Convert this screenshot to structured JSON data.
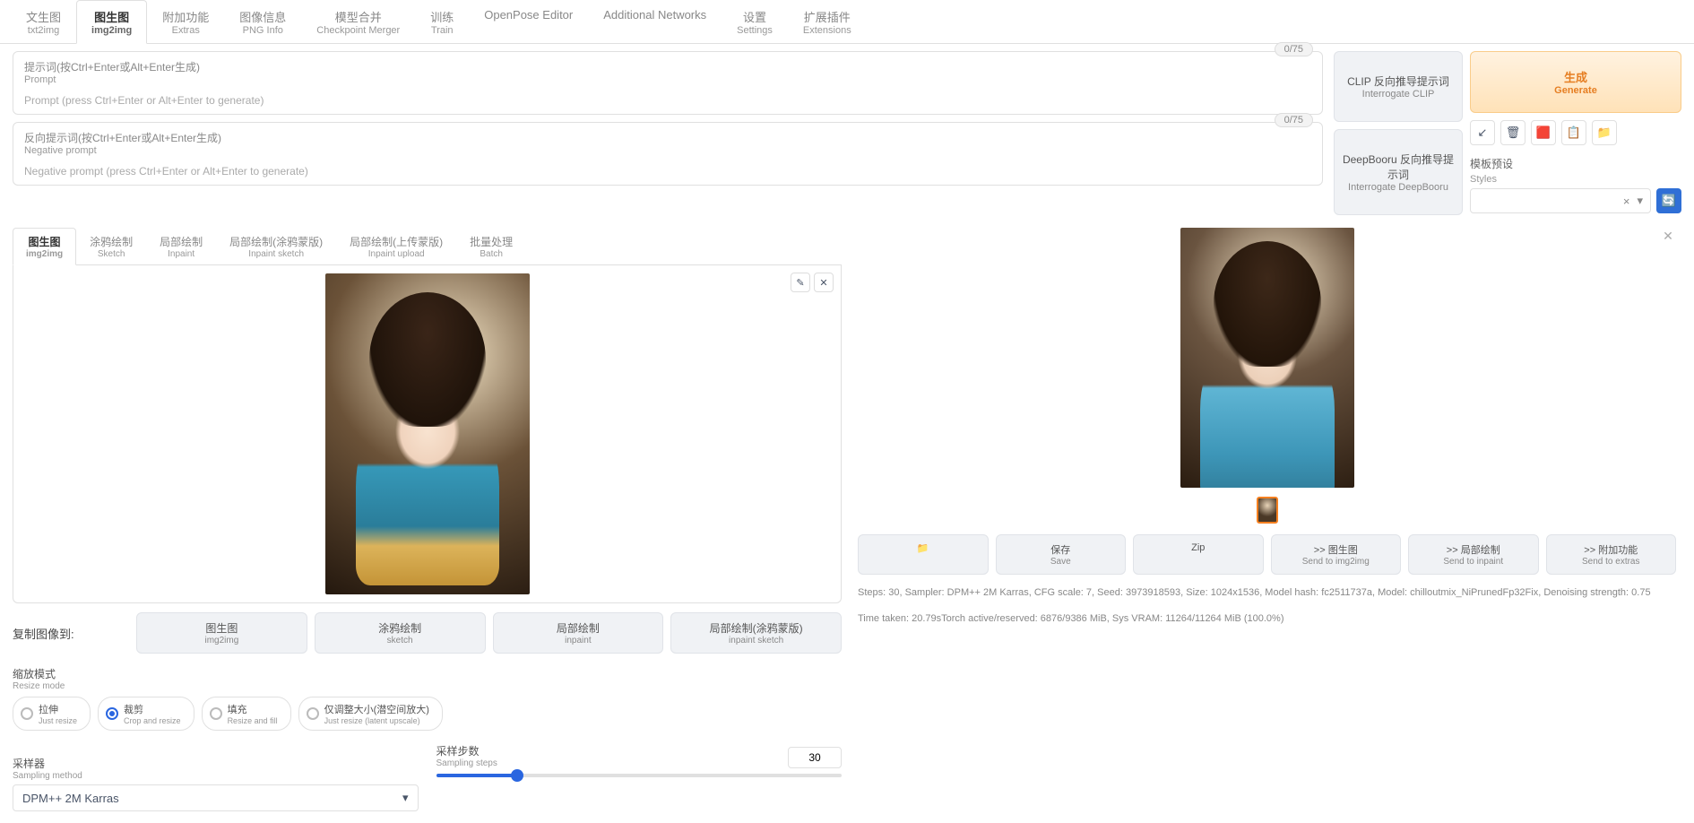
{
  "mainTabs": [
    {
      "cn": "文生图",
      "en": "txt2img"
    },
    {
      "cn": "图生图",
      "en": "img2img"
    },
    {
      "cn": "附加功能",
      "en": "Extras"
    },
    {
      "cn": "图像信息",
      "en": "PNG Info"
    },
    {
      "cn": "模型合并",
      "en": "Checkpoint Merger"
    },
    {
      "cn": "训练",
      "en": "Train"
    },
    {
      "cn": "",
      "en": "OpenPose Editor"
    },
    {
      "cn": "",
      "en": "Additional Networks"
    },
    {
      "cn": "设置",
      "en": "Settings"
    },
    {
      "cn": "扩展插件",
      "en": "Extensions"
    }
  ],
  "prompt": {
    "labelCn": "提示词(按Ctrl+Enter或Alt+Enter生成)",
    "labelEn": "Prompt",
    "placeholder": "Prompt (press Ctrl+Enter or Alt+Enter to generate)",
    "token": "0/75"
  },
  "negPrompt": {
    "labelCn": "反向提示词(按Ctrl+Enter或Alt+Enter生成)",
    "labelEn": "Negative prompt",
    "placeholder": "Negative prompt (press Ctrl+Enter or Alt+Enter to generate)",
    "token": "0/75"
  },
  "interrogate": {
    "clipCn": "CLIP 反向推导提示词",
    "clipEn": "Interrogate CLIP",
    "booruCn": "DeepBooru 反向推导提示词",
    "booruEn": "Interrogate DeepBooru"
  },
  "generate": {
    "cn": "生成",
    "en": "Generate"
  },
  "styles": {
    "cn": "模板预设",
    "en": "Styles",
    "clear": "×",
    "chev": "▾"
  },
  "subTabs": [
    {
      "cn": "图生图",
      "en": "img2img"
    },
    {
      "cn": "涂鸦绘制",
      "en": "Sketch"
    },
    {
      "cn": "局部绘制",
      "en": "Inpaint"
    },
    {
      "cn": "局部绘制(涂鸦蒙版)",
      "en": "Inpaint sketch"
    },
    {
      "cn": "局部绘制(上传蒙版)",
      "en": "Inpaint upload"
    },
    {
      "cn": "批量处理",
      "en": "Batch"
    }
  ],
  "copyLabel": "复制图像到:",
  "copyDests": [
    {
      "cn": "图生图",
      "en": "img2img"
    },
    {
      "cn": "涂鸦绘制",
      "en": "sketch"
    },
    {
      "cn": "局部绘制",
      "en": "inpaint"
    },
    {
      "cn": "局部绘制(涂鸦蒙版)",
      "en": "inpaint sketch"
    }
  ],
  "resizeMode": {
    "cn": "缩放模式",
    "en": "Resize mode"
  },
  "resizeOpts": [
    {
      "cn": "拉伸",
      "en": "Just resize"
    },
    {
      "cn": "裁剪",
      "en": "Crop and resize"
    },
    {
      "cn": "填充",
      "en": "Resize and fill"
    },
    {
      "cn": "仅调整大小(潜空间放大)",
      "en": "Just resize (latent upscale)"
    }
  ],
  "sampler": {
    "labelCn": "采样器",
    "labelEn": "Sampling method",
    "value": "DPM++ 2M Karras"
  },
  "steps": {
    "labelCn": "采样步数",
    "labelEn": "Sampling steps",
    "value": "30"
  },
  "actions": [
    {
      "cn": "📁",
      "en": ""
    },
    {
      "cn": "保存",
      "en": "Save"
    },
    {
      "cn": "Zip",
      "en": ""
    },
    {
      "cn": ">> 图生图",
      "en": "Send to img2img"
    },
    {
      "cn": ">> 局部绘制",
      "en": "Send to inpaint"
    },
    {
      "cn": ">> 附加功能",
      "en": "Send to extras"
    }
  ],
  "info1": "Steps: 30, Sampler: DPM++ 2M Karras, CFG scale: 7, Seed: 3973918593, Size: 1024x1536, Model hash: fc2511737a, Model: chilloutmix_NiPrunedFp32Fix, Denoising strength: 0.75",
  "info2": "Time taken: 20.79sTorch active/reserved: 6876/9386 MiB, Sys VRAM: 11264/11264 MiB (100.0%)",
  "icons": {
    "arrow": "↙",
    "trash": "🗑",
    "red": "🟥",
    "clip": "📋",
    "folder": "📁",
    "pencil": "✎",
    "x": "✕",
    "refresh": "🔄",
    "chev": "▾"
  }
}
